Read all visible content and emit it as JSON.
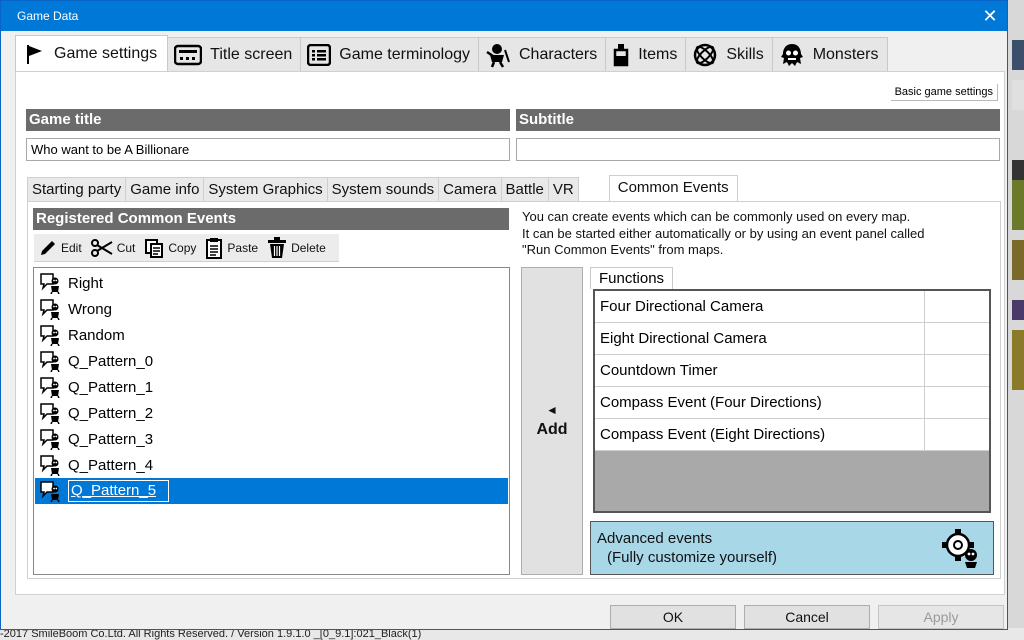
{
  "window": {
    "title": "Game Data",
    "close_glyph": "✕"
  },
  "main_tabs": [
    {
      "label": "Game settings",
      "icon": "flag-icon"
    },
    {
      "label": "Title screen",
      "icon": "title-screen-icon"
    },
    {
      "label": "Game terminology",
      "icon": "list-icon"
    },
    {
      "label": "Characters",
      "icon": "character-icon"
    },
    {
      "label": "Items",
      "icon": "item-icon"
    },
    {
      "label": "Skills",
      "icon": "skill-icon"
    },
    {
      "label": "Monsters",
      "icon": "monster-icon"
    }
  ],
  "basic_settings_label": "Basic game settings",
  "game_title": {
    "header": "Game title",
    "value": "Who want to be A Billionare"
  },
  "subtitle": {
    "header": "Subtitle",
    "value": ""
  },
  "sub_tabs": [
    "Starting party",
    "Game info",
    "System Graphics",
    "System sounds",
    "Camera",
    "Battle",
    "VR",
    "Common Events"
  ],
  "registered": {
    "header": "Registered Common Events",
    "toolbar": {
      "edit": "Edit",
      "cut": "Cut",
      "copy": "Copy",
      "paste": "Paste",
      "delete": "Delete"
    },
    "events": [
      "Right",
      "Wrong",
      "Random",
      "Q_Pattern_0",
      "Q_Pattern_1",
      "Q_Pattern_2",
      "Q_Pattern_3",
      "Q_Pattern_4",
      "Q_Pattern_5"
    ],
    "selected_index": 8
  },
  "description": {
    "line1": "You can create events which can be commonly used on every map.",
    "line2": "It can be started either automatically or by using an event panel called",
    "line3": "\"Run Common Events\" from maps."
  },
  "add_button": {
    "arrow": "◄",
    "label": "Add"
  },
  "functions": {
    "tab_label": "Functions",
    "items": [
      "Four Directional Camera",
      "Eight Directional Camera",
      "Countdown Timer",
      "Compass Event (Four Directions)",
      "Compass Event (Eight Directions)"
    ]
  },
  "advanced": {
    "line1": "Advanced events",
    "line2": "(Fully customize yourself)",
    "icon": "gear-character-icon"
  },
  "buttons": {
    "ok": "OK",
    "cancel": "Cancel",
    "apply": "Apply"
  },
  "footer": "-2017 SmileBoom Co.Ltd. All Rights Reserved. / Version 1.9.1.0 _[0_9.1]:021_Black(1)"
}
